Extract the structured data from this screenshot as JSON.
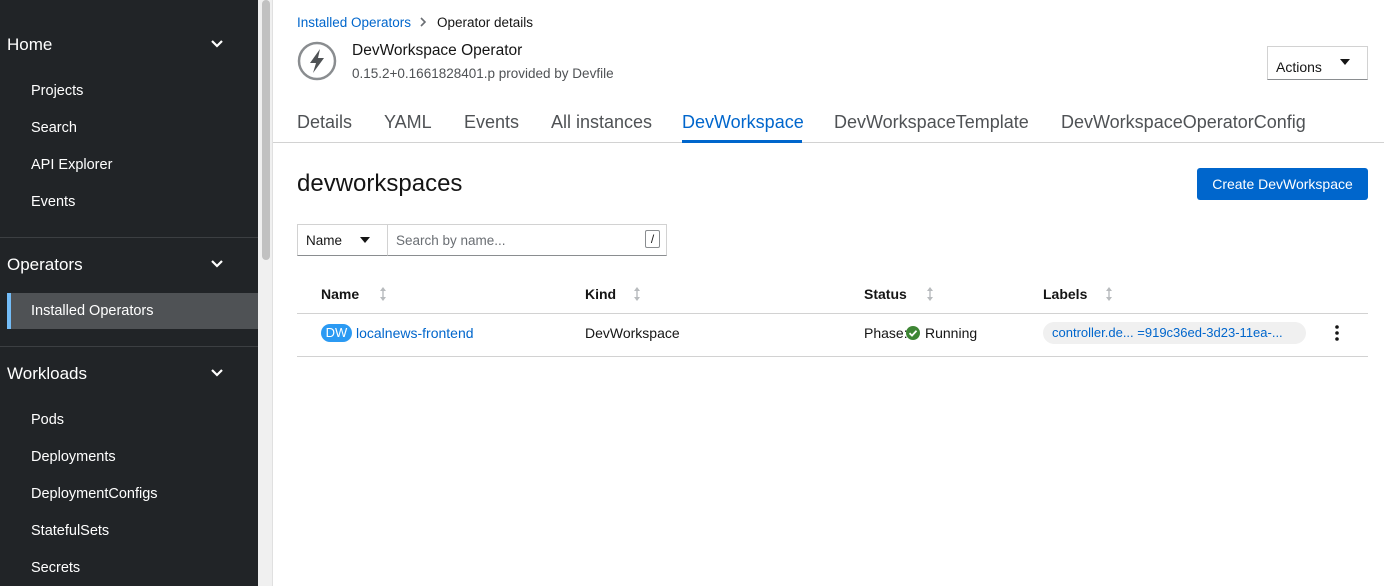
{
  "sidebar": {
    "sections": [
      {
        "title": "Home",
        "items": [
          "Projects",
          "Search",
          "API Explorer",
          "Events"
        ]
      },
      {
        "title": "Operators",
        "items": [
          "Installed Operators"
        ]
      },
      {
        "title": "Workloads",
        "items": [
          "Pods",
          "Deployments",
          "DeploymentConfigs",
          "StatefulSets",
          "Secrets"
        ]
      }
    ],
    "active_item": "Installed Operators",
    "active_accent": "#73bcf7"
  },
  "breadcrumb": {
    "link": "Installed Operators",
    "current": "Operator details"
  },
  "operator": {
    "name": "DevWorkspace Operator",
    "subtitle": "0.15.2+0.1661828401.p provided by Devfile",
    "icon": "lightning-bolt-icon"
  },
  "actions_label": "Actions",
  "tabs": [
    "Details",
    "YAML",
    "Events",
    "All instances",
    "DevWorkspace",
    "DevWorkspaceTemplate",
    "DevWorkspaceOperatorConfig"
  ],
  "active_tab": "DevWorkspace",
  "page_heading": "devworkspaces",
  "create_button": "Create DevWorkspace",
  "filter": {
    "selected": "Name",
    "placeholder": "Search by name...",
    "shortcut": "/"
  },
  "table": {
    "columns": [
      "Name",
      "Kind",
      "Status",
      "Labels"
    ],
    "rows": [
      {
        "badge": "DW",
        "name": "localnews-frontend",
        "kind": "DevWorkspace",
        "status_prefix": "Phase:",
        "status": "Running",
        "label": "controller.de... =919c36ed-3d23-11ea-..."
      }
    ]
  },
  "colors": {
    "sidebar_bg": "#212427",
    "link": "#0066cc",
    "primary_button": "#0066cc",
    "status_ok": "#3e8635",
    "badge": "#2b9af3"
  }
}
